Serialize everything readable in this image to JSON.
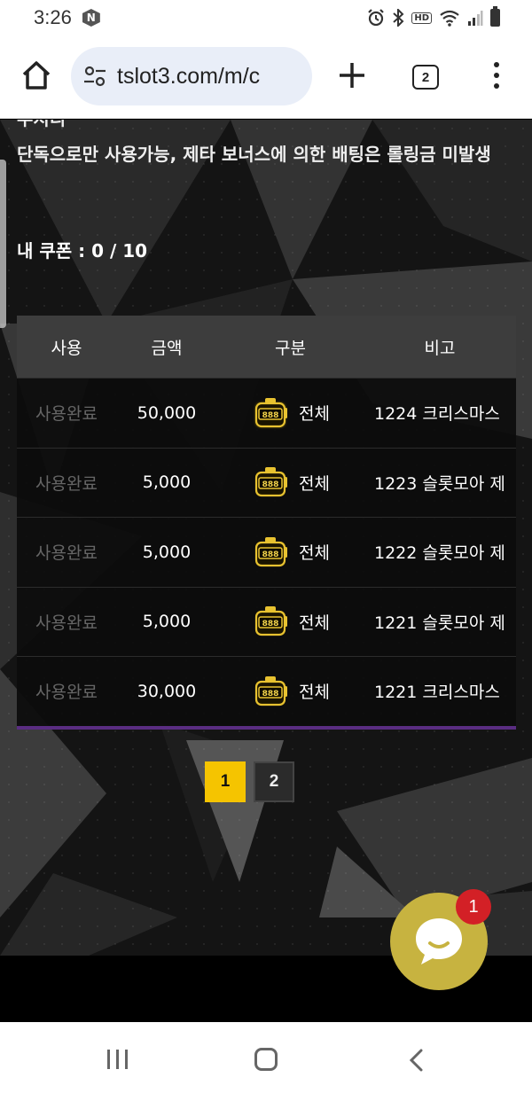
{
  "status_bar": {
    "time": "3:26",
    "notification_badge": "N",
    "hd_label": "HD"
  },
  "browser": {
    "url": "tslot3.com/m/c",
    "tab_count": "2"
  },
  "page": {
    "cut_off_line": "주지디",
    "description": "단독으로만 사용가능, 제타 보너스에 의한 배팅은 롤링금 미발생",
    "coupon_count": "내 쿠폰 : 0 / 10",
    "table": {
      "headers": [
        "사용",
        "금액",
        "구분",
        "비고"
      ],
      "rows": [
        {
          "status": "사용완료",
          "amount": "50,000",
          "type": "전체",
          "note": "1224 크리스마스"
        },
        {
          "status": "사용완료",
          "amount": "5,000",
          "type": "전체",
          "note": "1223 슬롯모아 제"
        },
        {
          "status": "사용완료",
          "amount": "5,000",
          "type": "전체",
          "note": "1222 슬롯모아 제"
        },
        {
          "status": "사용완료",
          "amount": "5,000",
          "type": "전체",
          "note": "1221 슬롯모아 제"
        },
        {
          "status": "사용완료",
          "amount": "30,000",
          "type": "전체",
          "note": "1221 크리스마스"
        }
      ]
    },
    "pagination": {
      "pages": [
        "1",
        "2"
      ],
      "current": "1"
    },
    "chat": {
      "unread_count": "1"
    }
  },
  "colors": {
    "accent_yellow": "#f5c400",
    "chat_bubble": "#c7b340",
    "badge_red": "#d32026",
    "table_bottom_border": "#5a2d82",
    "muted_text": "#666666"
  },
  "icons": {
    "home": "home-icon",
    "url_settings": "tune-icon",
    "new_tab": "plus-icon",
    "tabs": "tabs-icon",
    "menu": "more-vert-icon",
    "slot_machine": "slot-machine-icon",
    "chat": "chat-icon"
  }
}
